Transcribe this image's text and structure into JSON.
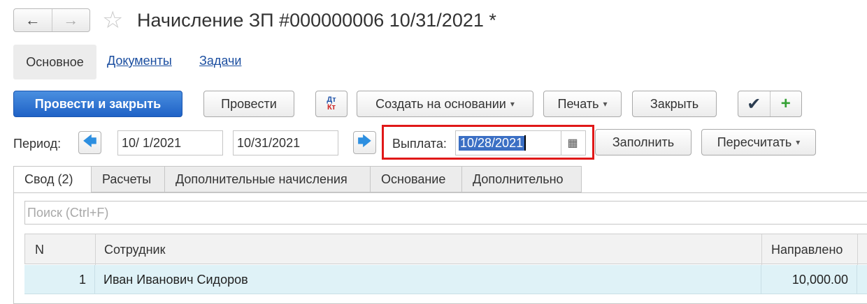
{
  "header": {
    "back_label": "←",
    "forward_label": "→",
    "star_glyph": "☆",
    "title": "Начисление ЗП #000000006 10/31/2021 *"
  },
  "top_tabs": {
    "main": "Основное",
    "documents": "Документы",
    "tasks": "Задачи"
  },
  "toolbar": {
    "post_close": "Провести и закрыть",
    "post": "Провести",
    "dt": "Дт",
    "kt": "Кт",
    "create_based": "Создать на основании",
    "print": "Печать",
    "close": "Закрыть",
    "check_glyph": "✔",
    "plus_glyph": "+"
  },
  "period": {
    "label": "Период:",
    "prev_glyph": "🡄",
    "next_glyph": "🡆",
    "start": "10/ 1/2021",
    "end": "10/31/2021",
    "payment_label": "Выплата:",
    "payment_date": "10/28/2021",
    "calendar_glyph": "▦",
    "fill": "Заполнить",
    "recalc": "Пересчитать"
  },
  "content_tabs": {
    "summary": "Свод (2)",
    "calc": "Расчеты",
    "additional_accruals": "Дополнительные начисления",
    "basis": "Основание",
    "extra": "Дополнительно"
  },
  "search": {
    "placeholder": "Поиск (Ctrl+F)"
  },
  "table": {
    "columns": [
      "N",
      "Сотрудник",
      "Направлено"
    ],
    "rows": [
      {
        "n": "1",
        "employee": "Иван Иванович Сидоров",
        "sent": "10,000.00"
      }
    ]
  },
  "colors": {
    "primary_button": "#1f62c6",
    "highlight_box": "#e01818",
    "selected_row": "#dff2f7",
    "link": "#1b4ea0"
  }
}
